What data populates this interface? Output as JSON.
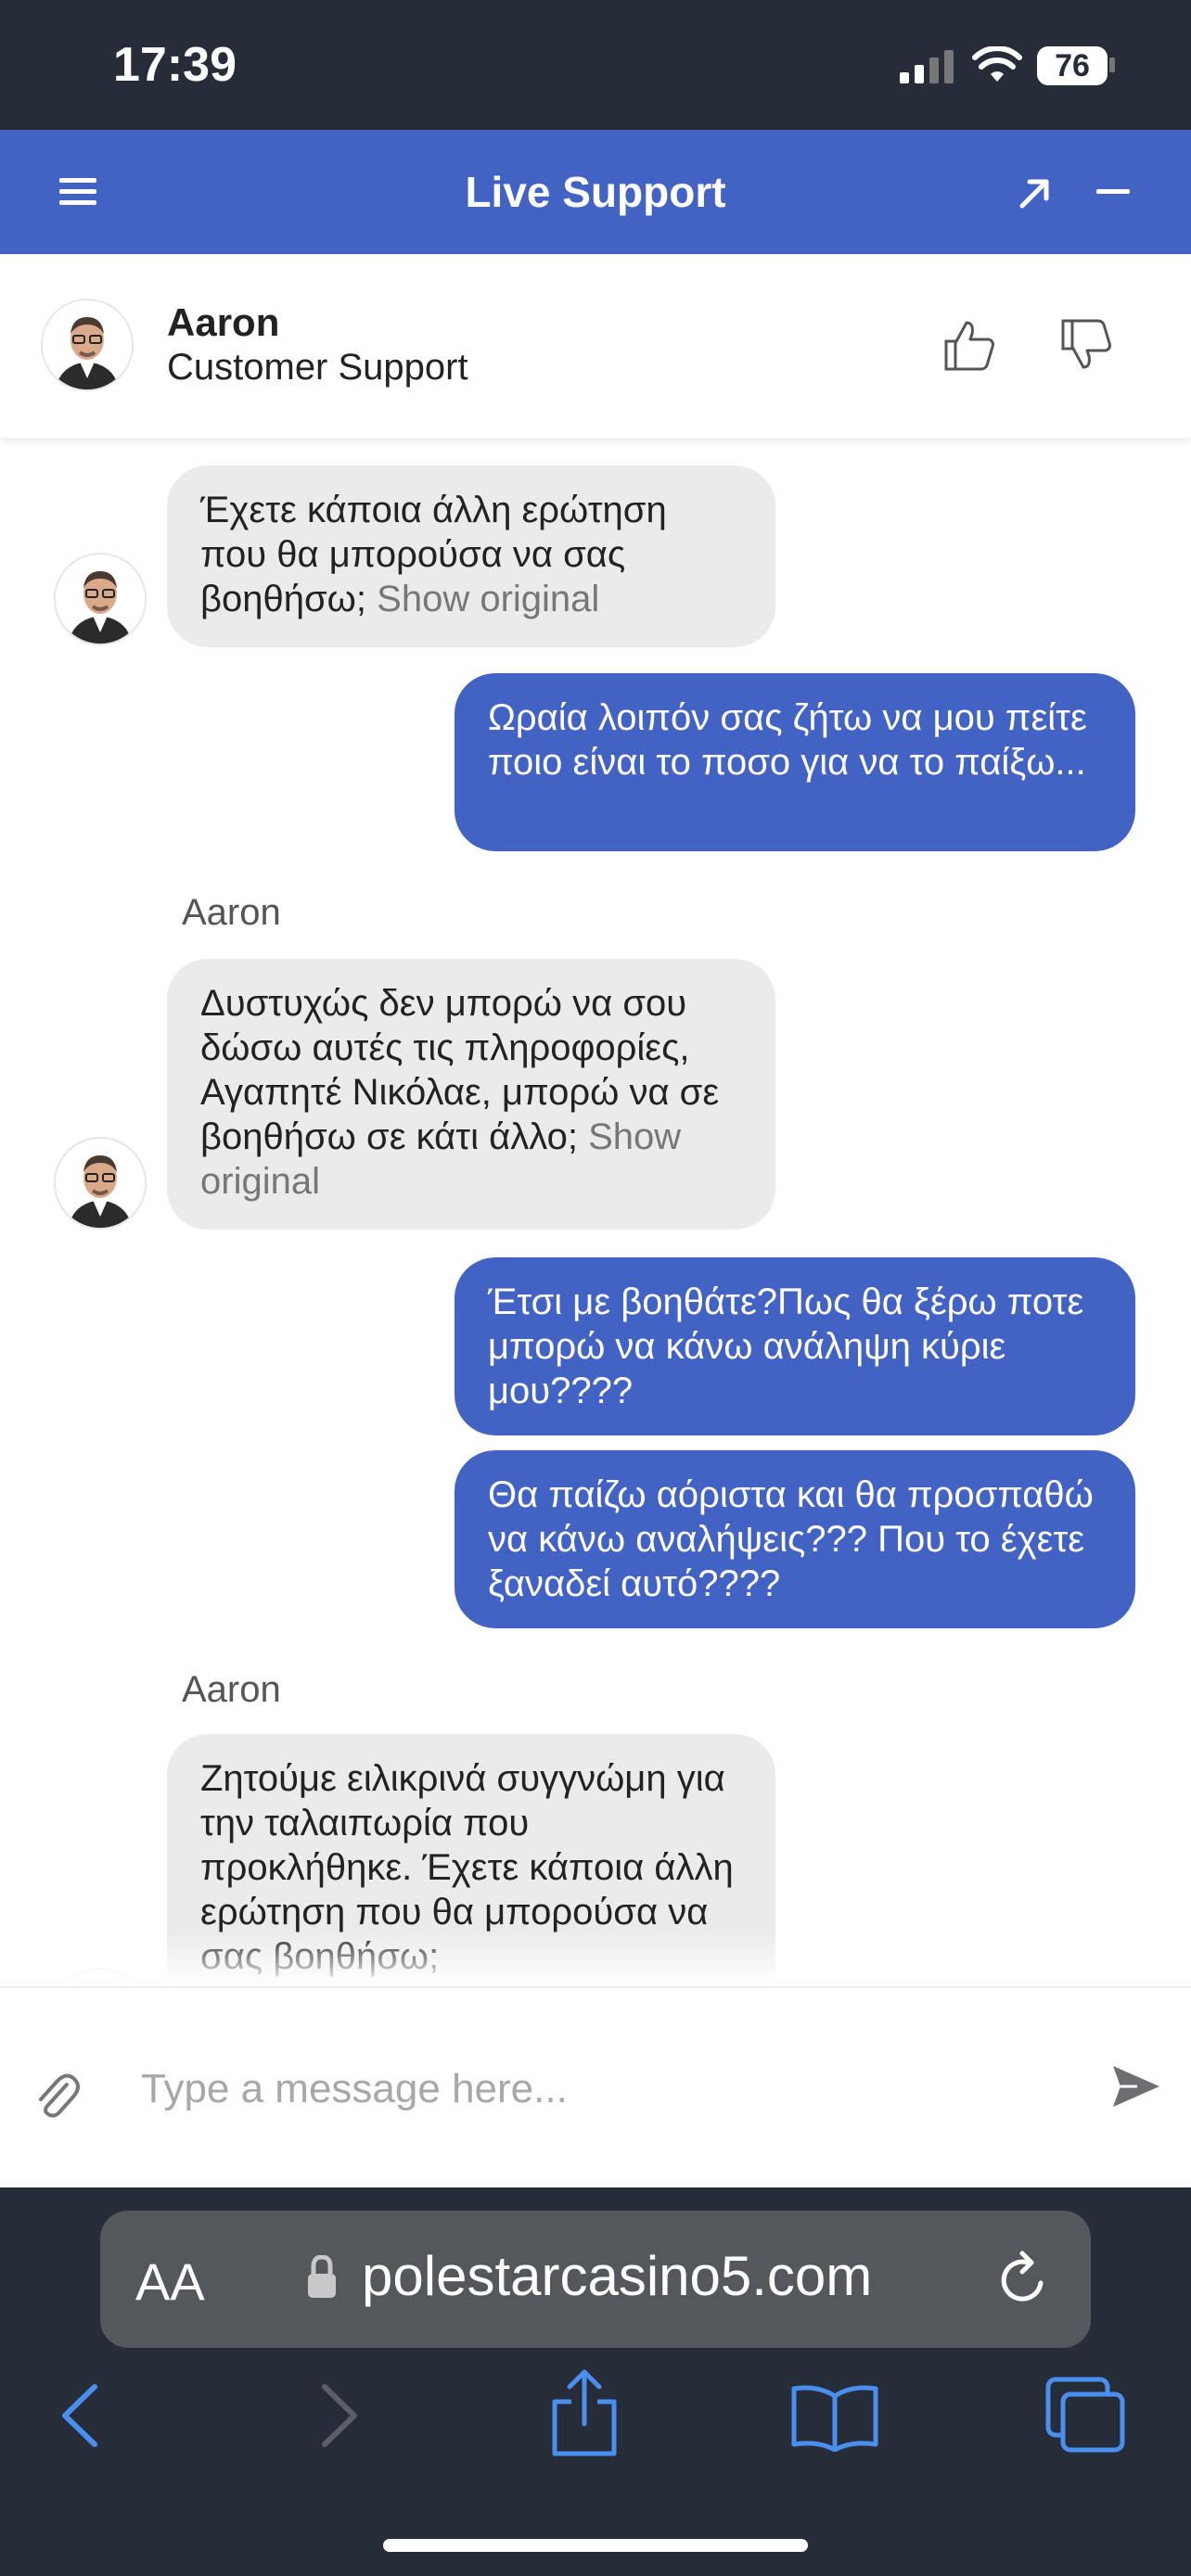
{
  "status": {
    "time": "17:39",
    "battery": "76"
  },
  "header": {
    "title": "Live Support"
  },
  "agent": {
    "name": "Aaron",
    "role": "Customer Support"
  },
  "messages": {
    "m1": {
      "text": "Έχετε κάποια άλλη ερώτηση που θα μπορούσα να σας βοηθήσω;",
      "show_original": "Show original"
    },
    "m2": {
      "text": "Ωραία λοιπόν σας ζήτω να μου πείτε ποιο είναι το ποσο για να το παίξω..."
    },
    "sender2": "Aaron",
    "m3": {
      "text": "Δυστυχώς δεν μπορώ να σου δώσω αυτές τις πληροφορίες, Αγαπητέ Νικόλαε, μπορώ να σε βοηθήσω σε κάτι άλλο;",
      "show_original": "Show original"
    },
    "m4": {
      "text": "Έτσι με βοηθάτε?Πως θα ξέρω ποτε μπορώ να κάνω ανάληψη κύριε μου????"
    },
    "m5": {
      "text": "Θα παίζω αόριστα και θα προσπαθώ να κάνω αναλήψεις??? Που το έχετε ξαναδεί αυτό????"
    },
    "sender3": "Aaron",
    "m6": {
      "text": "Ζητούμε ειλικρινά συγγνώμη για την ταλαιπωρία που προκλήθηκε. Έχετε κάποια άλλη ερώτηση που θα μπορούσα να σας βοηθήσω;"
    }
  },
  "composer": {
    "placeholder": "Type a message here..."
  },
  "browser": {
    "aa": "AA",
    "url": "polestarcasino5.com"
  },
  "colors": {
    "accent": "#4363c4",
    "incoming": "#ebebed",
    "chrome": "#262d38",
    "browser_icon": "#4a8ff0"
  }
}
